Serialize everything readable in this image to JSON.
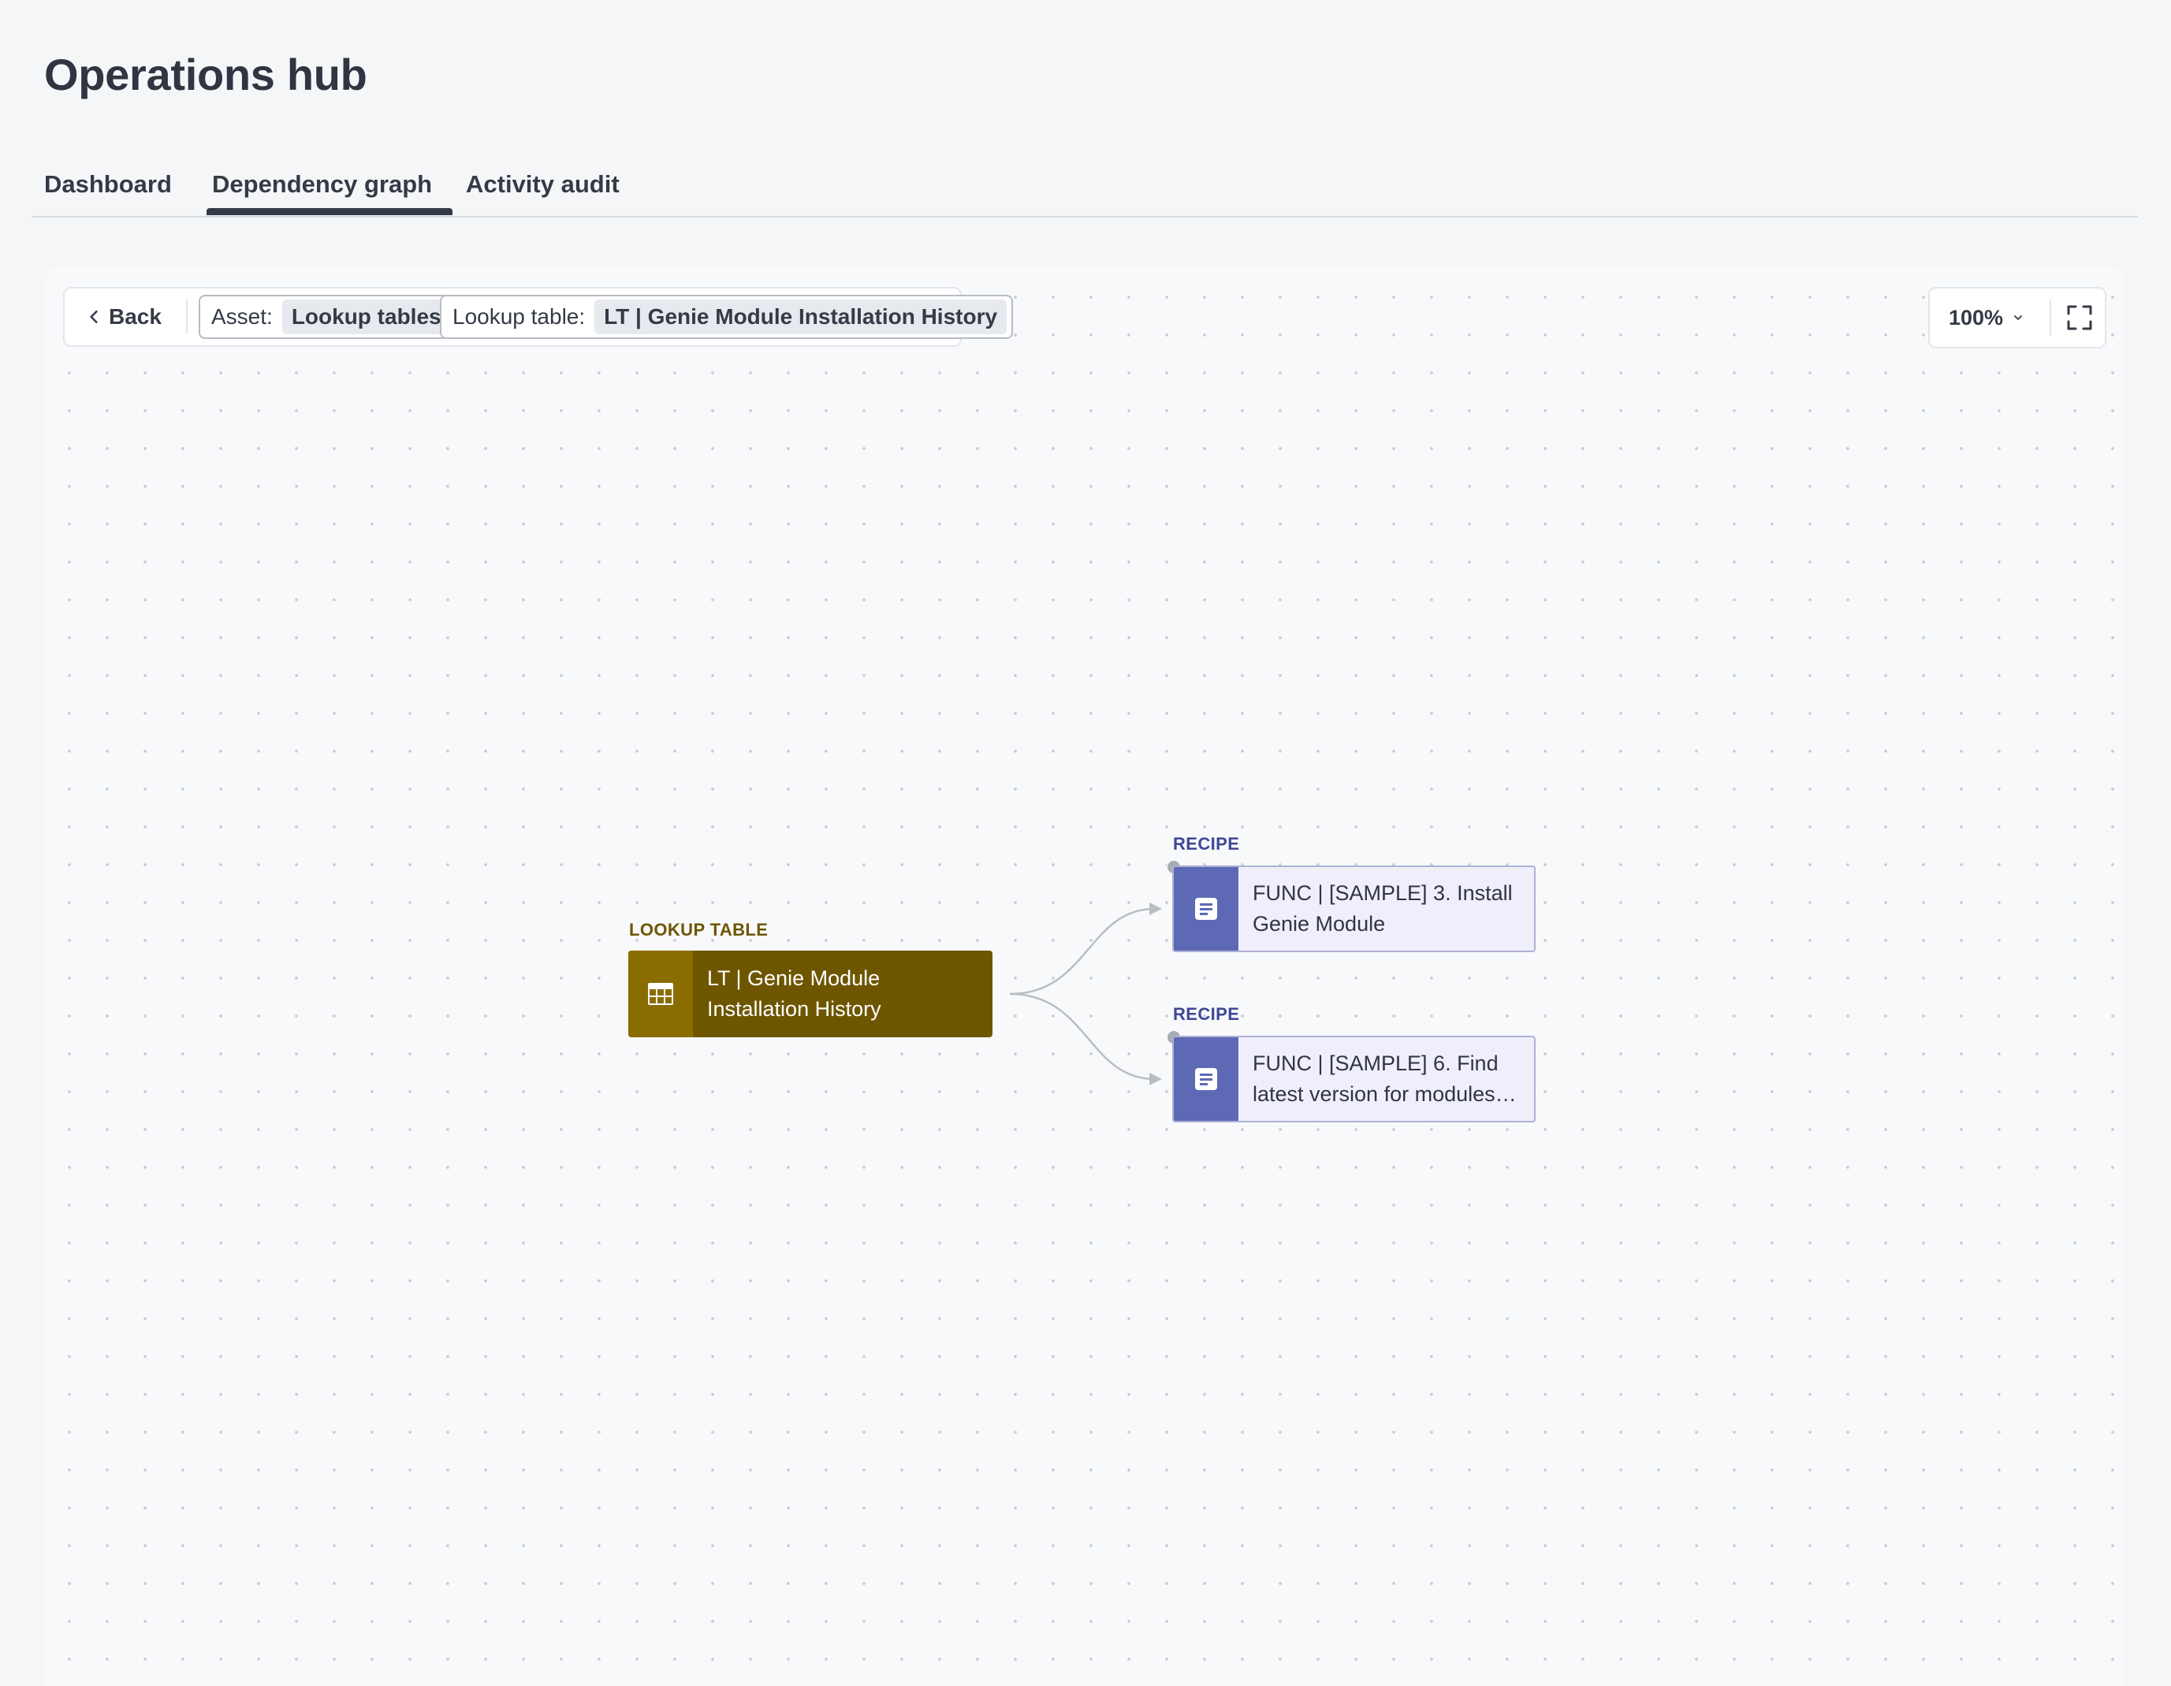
{
  "header": {
    "title": "Operations hub"
  },
  "tabs": [
    {
      "label": "Dashboard",
      "active": false
    },
    {
      "label": "Dependency graph",
      "active": true
    },
    {
      "label": "Activity audit",
      "active": false
    }
  ],
  "toolbar": {
    "back_label": "Back",
    "chips": [
      {
        "label": "Asset:",
        "value": "Lookup tables"
      },
      {
        "label": "Lookup table:",
        "value": "LT | Genie Module Installation History"
      }
    ],
    "zoom": "100%"
  },
  "graph": {
    "source": {
      "type_label": "LOOKUP TABLE",
      "name": "LT | Genie Module Installation History",
      "icon": "table-icon"
    },
    "targets": [
      {
        "type_label": "RECIPE",
        "name": "FUNC | [SAMPLE] 3. Install Genie Module",
        "icon": "recipe-icon"
      },
      {
        "type_label": "RECIPE",
        "name": "FUNC | [SAMPLE] 6. Find latest version for modules …",
        "icon": "recipe-icon"
      }
    ]
  },
  "colors": {
    "lookup_table_label": "#6e5600",
    "lookup_table_node": "#6e5600",
    "lookup_table_icon_bg": "#8a6d00",
    "recipe_label": "#3e4896",
    "recipe_node_bg": "#efeefa",
    "recipe_icon_bg": "#5e69b5",
    "edge": "#b9bcc2"
  }
}
